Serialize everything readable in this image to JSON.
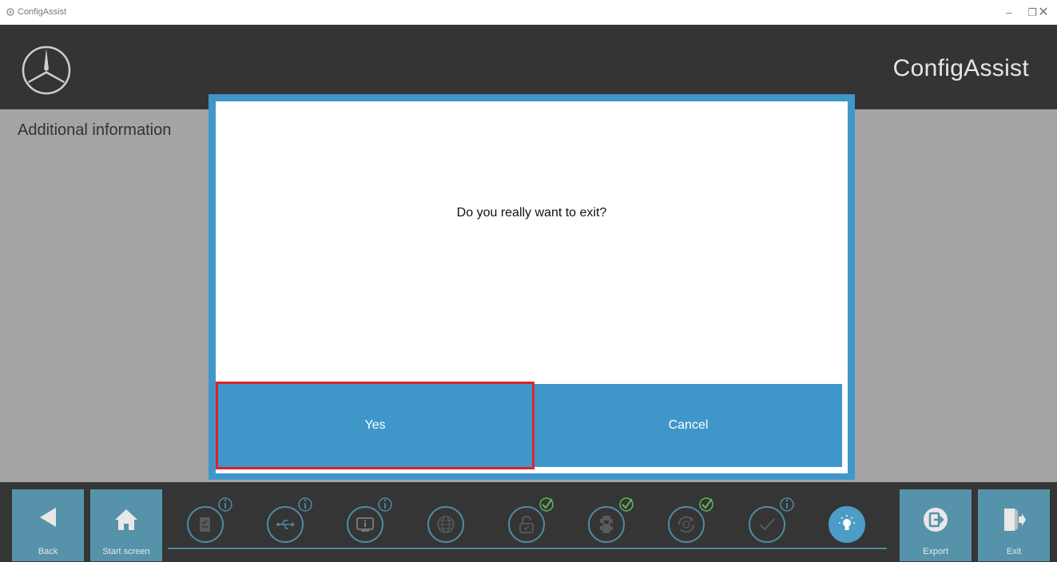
{
  "window": {
    "title": "ConfigAssist",
    "icon": "gear-icon",
    "controls": {
      "minimize": "–",
      "restore": "❐",
      "close": "✕"
    }
  },
  "header": {
    "logo": "mercedes-star-logo",
    "brand": "ConfigAssist"
  },
  "main": {
    "section_title": "Additional information"
  },
  "dialog": {
    "question": "Do you really want to exit?",
    "yes_label": "Yes",
    "cancel_label": "Cancel",
    "accent_color": "#3f97c9",
    "focus_color": "#e0222b"
  },
  "footer": {
    "back_label": "Back",
    "start_label": "Start screen",
    "export_label": "Export",
    "exit_label": "Exit",
    "steps": [
      {
        "icon": "document-checklist-icon",
        "badge": "info"
      },
      {
        "icon": "usb-icon",
        "badge": "info"
      },
      {
        "icon": "device-info-icon",
        "badge": "info"
      },
      {
        "icon": "globe-icon",
        "badge": "none"
      },
      {
        "icon": "unlock-icon",
        "badge": "check"
      },
      {
        "icon": "vehicle-icon",
        "badge": "check"
      },
      {
        "icon": "update-cycle-icon",
        "badge": "check"
      },
      {
        "icon": "checkmark-icon",
        "badge": "info"
      },
      {
        "icon": "lightbulb-icon",
        "badge": "active"
      }
    ]
  }
}
